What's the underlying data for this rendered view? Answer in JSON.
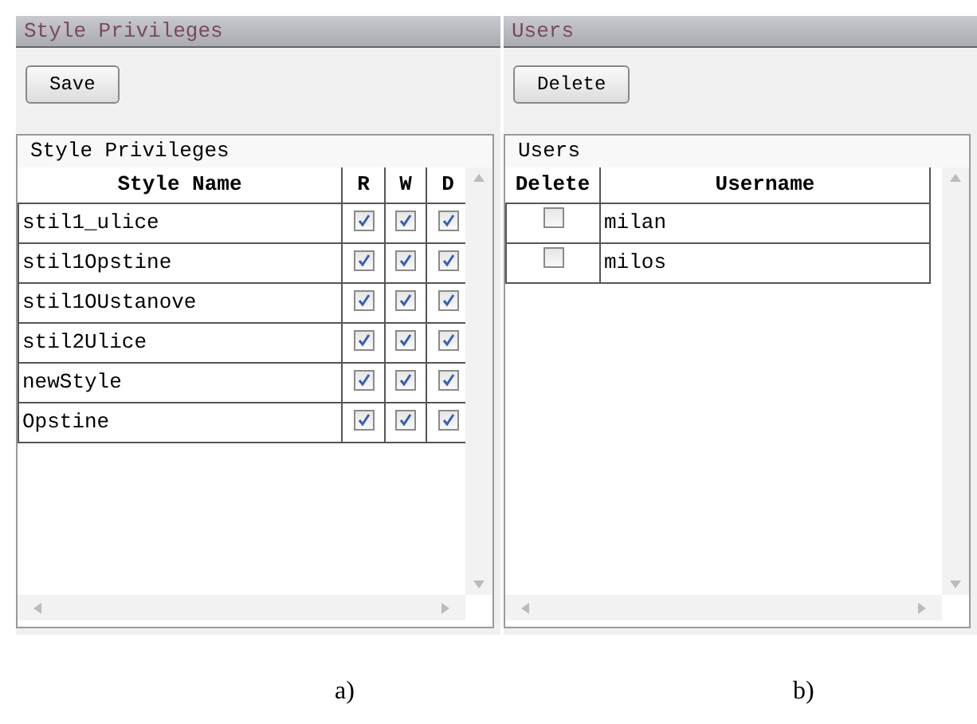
{
  "panels": [
    {
      "title": "Style Privileges",
      "button": "Save",
      "grid_caption": "Style Privileges",
      "columns": [
        "Style Name",
        "R",
        "W",
        "D"
      ],
      "rows": [
        {
          "name": "stil1_ulice",
          "r": true,
          "w": true,
          "d": true
        },
        {
          "name": "stil1Opstine",
          "r": true,
          "w": true,
          "d": true
        },
        {
          "name": "stil1OUstanove",
          "r": true,
          "w": true,
          "d": true
        },
        {
          "name": "stil2Ulice",
          "r": true,
          "w": true,
          "d": true
        },
        {
          "name": "newStyle",
          "r": true,
          "w": true,
          "d": true
        },
        {
          "name": "Opstine",
          "r": true,
          "w": true,
          "d": true
        }
      ]
    },
    {
      "title": "Users",
      "button": "Delete",
      "grid_caption": "Users",
      "columns": [
        "Delete",
        "Username"
      ],
      "rows": [
        {
          "delete": false,
          "username": "milan"
        },
        {
          "delete": false,
          "username": "milos"
        }
      ]
    }
  ],
  "captions": [
    "a)",
    "b)"
  ]
}
